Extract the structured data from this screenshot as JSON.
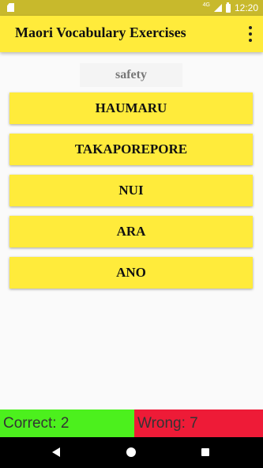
{
  "status_bar": {
    "network": "4G",
    "time": "12:20"
  },
  "app_bar": {
    "title": "Maori Vocabulary Exercises"
  },
  "question": {
    "word": "safety"
  },
  "answers": [
    "HAUMARU",
    "TAKAPOREPORE",
    "NUI",
    "ARA",
    "ANO"
  ],
  "score": {
    "correct_label": "Correct: 2",
    "wrong_label": "Wrong: 7"
  },
  "colors": {
    "accent": "#ffeb3b",
    "correct": "#4cf01d",
    "wrong": "#ee1b37"
  }
}
